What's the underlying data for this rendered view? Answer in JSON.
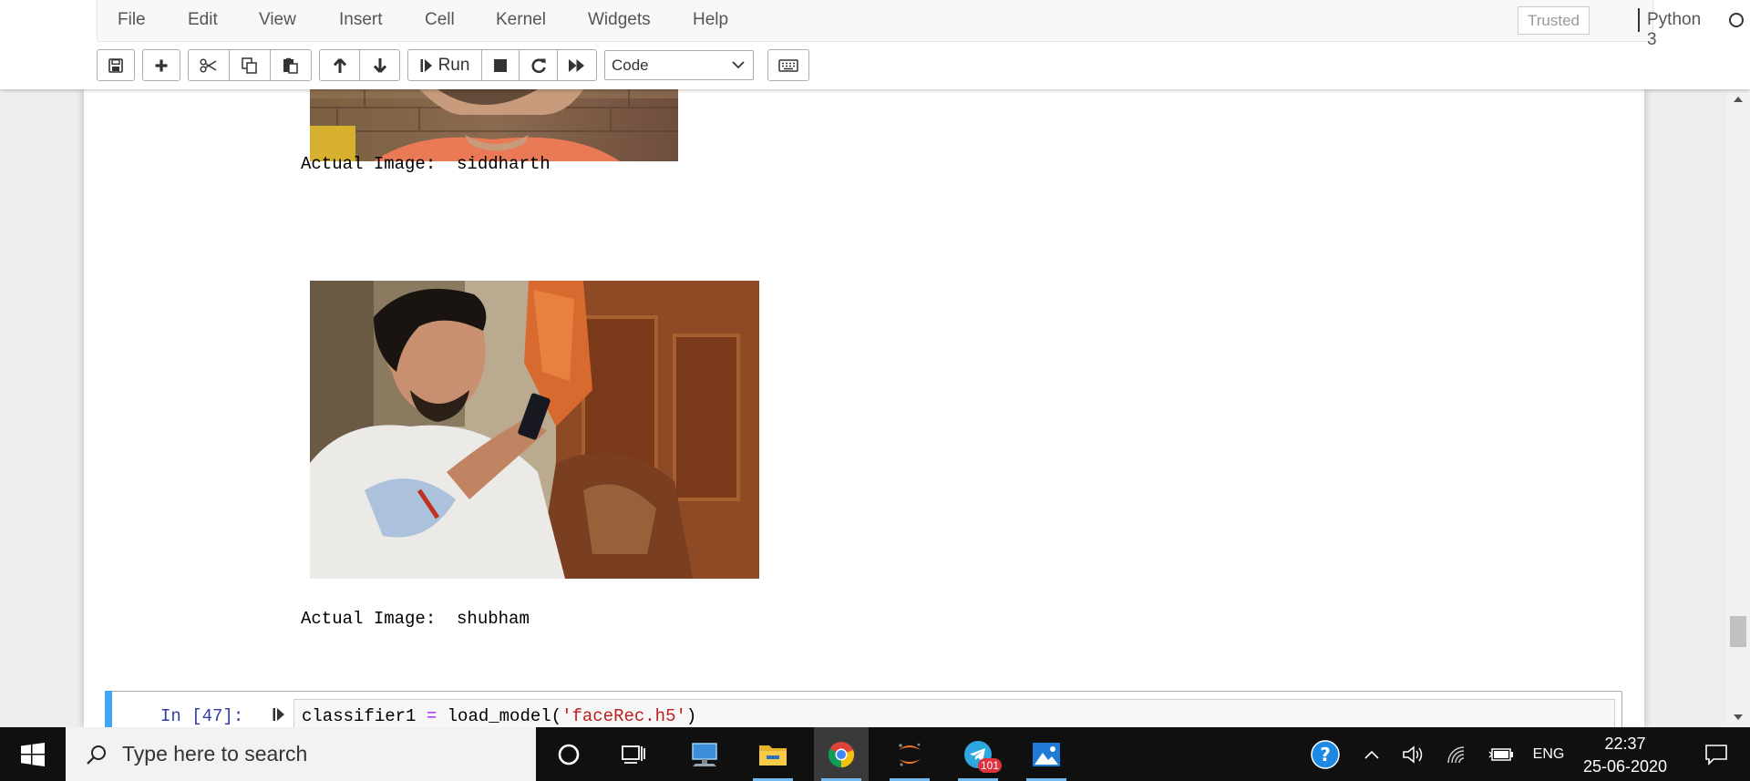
{
  "menubar": {
    "items": [
      "File",
      "Edit",
      "View",
      "Insert",
      "Cell",
      "Kernel",
      "Widgets",
      "Help"
    ],
    "trusted_label": "Trusted",
    "kernel_name": "Python 3"
  },
  "toolbar": {
    "run_label": "Run",
    "cell_type": "Code",
    "buttons": [
      "save-icon",
      "add-icon",
      "cut-icon",
      "copy-icon",
      "paste-icon",
      "arrow-up-icon",
      "arrow-down-icon",
      "run-icon",
      "stop-icon",
      "restart-icon",
      "fast-forward-icon",
      "keyboard-icon"
    ]
  },
  "notebook": {
    "outputs": [
      {
        "text": "Actual Image:  siddharth"
      },
      {
        "text": "Actual Image:  shubham"
      }
    ],
    "cell": {
      "prompt": "In [47]:",
      "code": {
        "var": "classifier1",
        "op": "=",
        "func": "load_model(",
        "arg": "'faceRec.h5'",
        "close": ")"
      }
    }
  },
  "taskbar": {
    "search_placeholder": "Type here to search",
    "apps": [
      "cortana-icon",
      "task-view-icon",
      "computer-icon",
      "file-explorer-icon",
      "chrome-icon",
      "jupyter-icon",
      "telegram-icon",
      "photos-icon"
    ],
    "telegram_badge": "101",
    "tray": {
      "language": "ENG",
      "time": "22:37",
      "date": "25-06-2020"
    }
  },
  "colors": {
    "accent_blue": "#42a5f5",
    "prompt_blue": "#303f9f",
    "string_red": "#ba2121",
    "taskbar_bg": "#101010"
  }
}
